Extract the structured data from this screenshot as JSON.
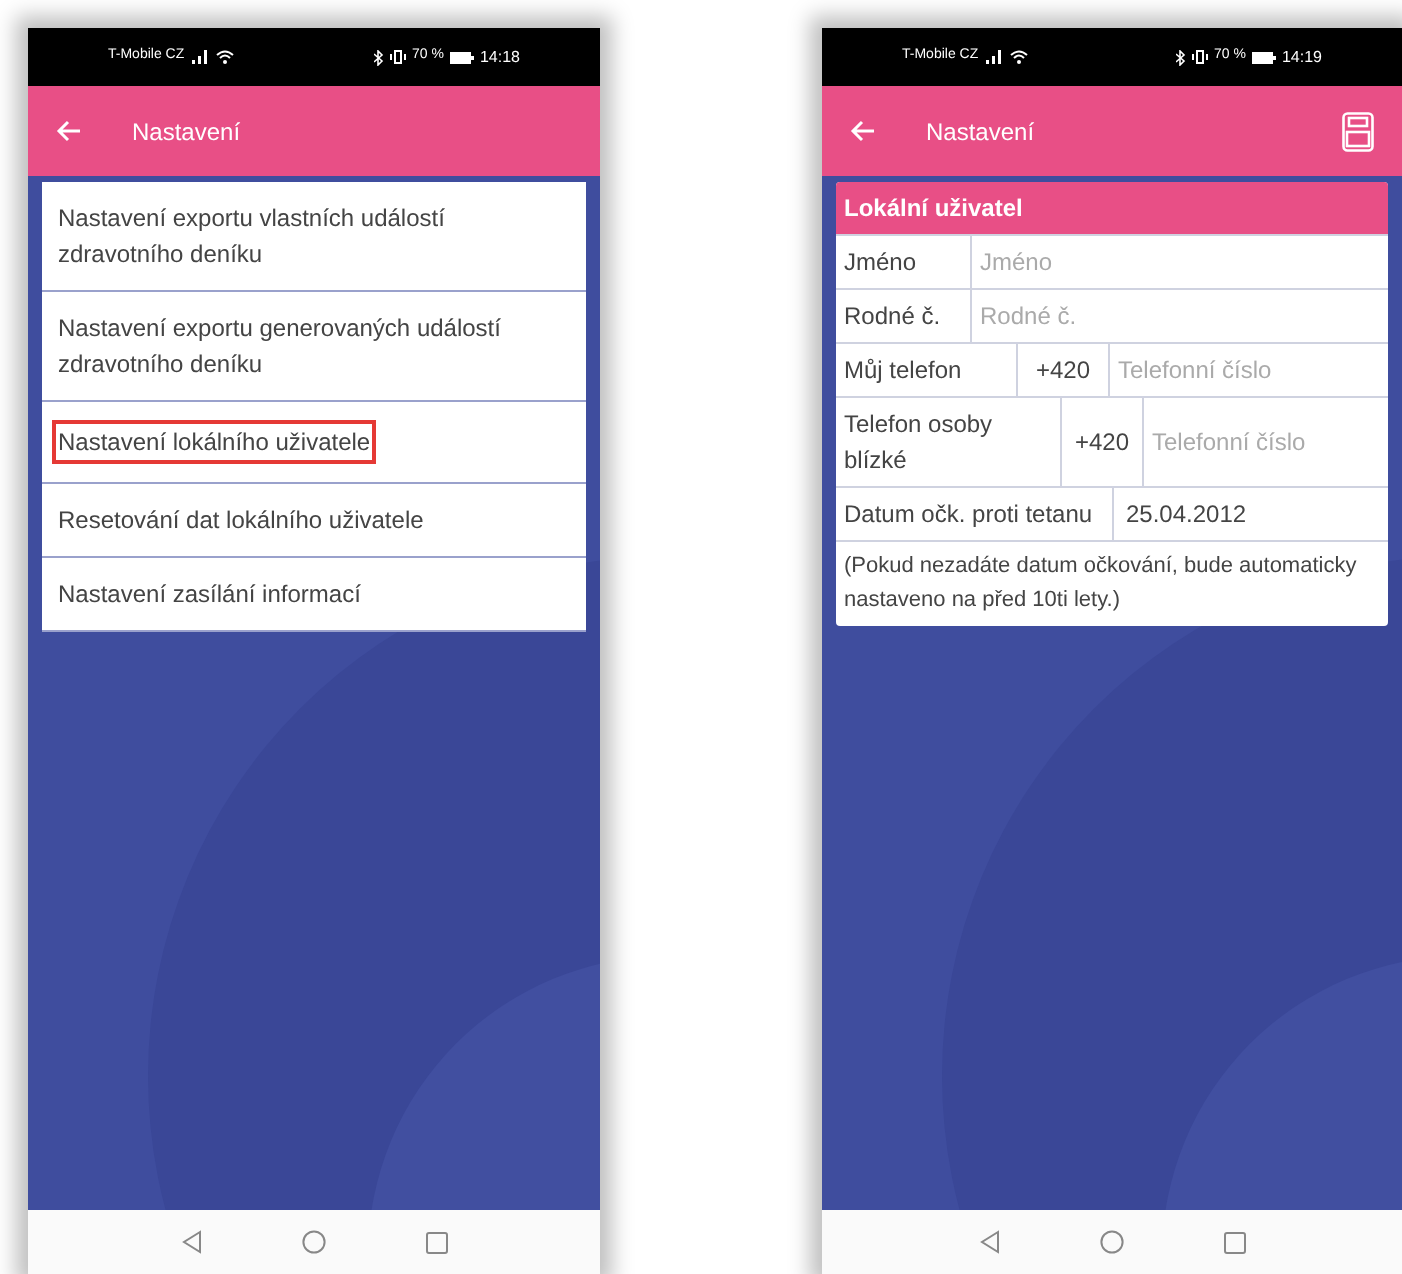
{
  "left_phone": {
    "status_bar": {
      "carrier": "T-Mobile CZ",
      "battery": "70 %",
      "time": "14:18"
    },
    "header": {
      "title": "Nastavení",
      "save": false
    },
    "menu": [
      {
        "label": "Nastavení exportu vlastních událostí zdravotního deníku",
        "highlighted": false
      },
      {
        "label": "Nastavení exportu generovaných událostí zdravotního deníku",
        "highlighted": false
      },
      {
        "label": "Nastavení lokálního uživatele",
        "highlighted": true
      },
      {
        "label": "Resetování dat lokálního uživatele",
        "highlighted": false
      },
      {
        "label": "Nastavení zasílání informací",
        "highlighted": false
      }
    ]
  },
  "right_phone": {
    "status_bar": {
      "carrier": "T-Mobile CZ",
      "battery": "70 %",
      "time": "14:19"
    },
    "header": {
      "title": "Nastavení",
      "save": true
    },
    "card": {
      "title": "Lokální uživatel",
      "rows": [
        {
          "kind": "text",
          "label": "Jméno",
          "placeholder": "Jméno"
        },
        {
          "kind": "text",
          "label": "Rodné č.",
          "placeholder": "Rodné č."
        },
        {
          "kind": "phone",
          "label": "Můj telefon",
          "prefix": "+420",
          "placeholder": "Telefonní číslo"
        },
        {
          "kind": "phone",
          "label": "Telefon osoby blízké",
          "prefix": "+420",
          "placeholder": "Telefonní číslo"
        },
        {
          "kind": "date",
          "label": "Datum očk. proti tetanu",
          "value": "25.04.2012"
        }
      ],
      "note": "(Pokud nezadáte datum očkování, bude automaticky nastaveno na před 10ti lety.)"
    }
  }
}
